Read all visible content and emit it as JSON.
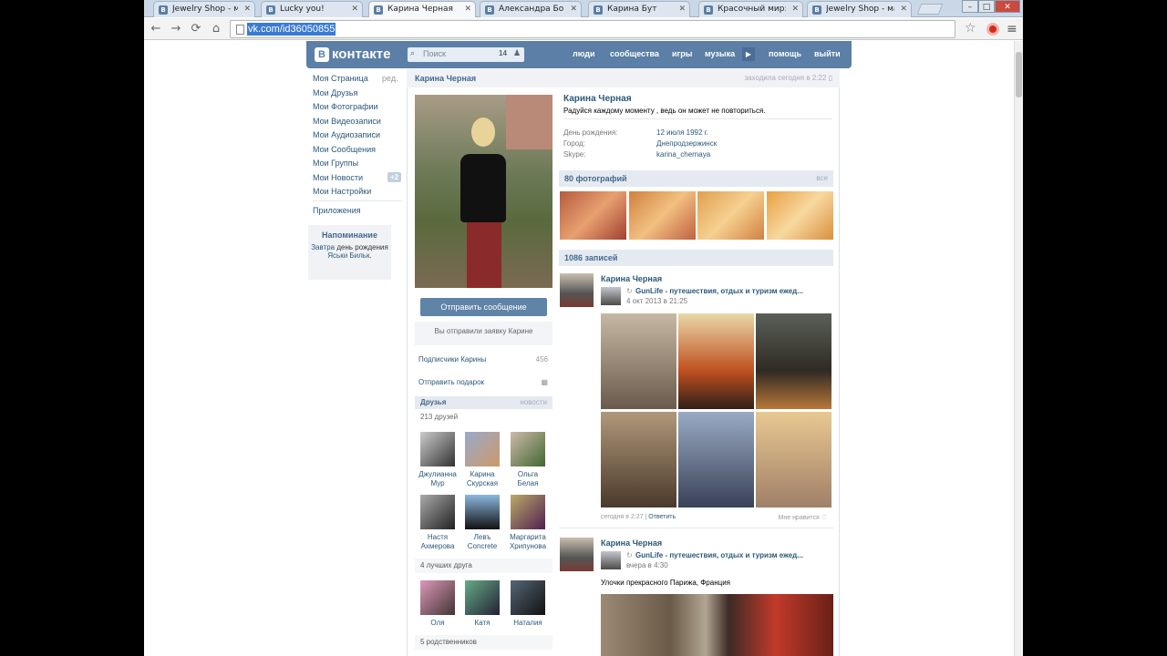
{
  "browser": {
    "tabs": [
      {
        "label": "Jewelry Shop - мага"
      },
      {
        "label": "Lucky you!"
      },
      {
        "label": "Карина Черная"
      },
      {
        "label": "Александра Бовча"
      },
      {
        "label": "Карина Бут"
      },
      {
        "label": "Красочный мир: Ус"
      },
      {
        "label": "Jewelry Shop - мага"
      }
    ],
    "url": "vk.com/id36050855",
    "window_controls": {
      "minimize": "–",
      "maximize": "□",
      "close": "✕"
    },
    "nav": {
      "back": "←",
      "forward": "→",
      "reload": "⟳",
      "home": "⌂",
      "star": "☆",
      "menu": "≡"
    }
  },
  "header": {
    "logo": "контакте",
    "logo_letter": "В",
    "search_placeholder": "Поиск",
    "search_count": "14",
    "nav": [
      "люди",
      "сообщества",
      "игры",
      "музыка",
      "помощь",
      "выйти"
    ],
    "play": "▶"
  },
  "left_nav": {
    "items": [
      "Моя Страница",
      "Мои Друзья",
      "Мои Фотографии",
      "Мои Видеозаписи",
      "Мои Аудиозаписи",
      "Мои Сообщения",
      "Мои Группы",
      "Мои Новости",
      "Мои Настройки"
    ],
    "edit": "ред.",
    "news_badge": "+2",
    "apps": "Приложения"
  },
  "reminder": {
    "title": "Напоминание",
    "word1": "Завтра",
    "word2": "день рождения",
    "name": "Яськи Бильк",
    "dot": "."
  },
  "profile": {
    "bar_name": "Карина Черная",
    "bar_online": "заходила сегодня в 2:22 ▯",
    "name": "Карина Черная",
    "status": "Радуйся каждому моменту , ведь он может не повториться.",
    "info": [
      {
        "k": "День рождения:",
        "v": "12 июля 1992 г."
      },
      {
        "k": "Город:",
        "v": "Днепродзержинск"
      },
      {
        "k": "Skype:",
        "v": "karina_chernaya"
      }
    ],
    "send_message": "Отправить сообщение",
    "request_note": "Вы отправили заявку Карине",
    "followers": "Подписчики Карины",
    "followers_count": "456",
    "gift": "Отправить подарок",
    "friends_title": "Друзья",
    "friends_link": "новости",
    "friends_count": "213 друзей",
    "friends": [
      {
        "first": "Джулианна",
        "last": "Мур"
      },
      {
        "first": "Карина",
        "last": "Скурская"
      },
      {
        "first": "Ольга",
        "last": "Белая"
      },
      {
        "first": "Настя",
        "last": "Ахмерова"
      },
      {
        "first": "Левъ",
        "last": "Concrete"
      },
      {
        "first": "Маргарита",
        "last": "Хрипунова"
      }
    ],
    "best_title": "4 лучших друга",
    "best": [
      {
        "first": "Оля"
      },
      {
        "first": "Катя"
      },
      {
        "first": "Наталия"
      }
    ],
    "relatives": "5 родственников"
  },
  "photos": {
    "title": "80 фотографий",
    "all": "все"
  },
  "wall": {
    "title": "1086 записей",
    "posts": [
      {
        "author": "Карина Черная",
        "source": "GunLife - путешествия, отдых и туризм ежед...",
        "date": "4 окт 2013 в 21:25",
        "footer_time": "сегодня в 2:27",
        "reply": "Ответить",
        "likes": "Мне нравится ♡"
      },
      {
        "author": "Карина Черная",
        "source": "GunLife - путешествия, отдых и туризм ежед...",
        "date": "вчера в 4:30",
        "text": "Улочки прекрасного Парижа, Франция"
      }
    ]
  },
  "colors": {
    "vk_blue": "#5b7fa6",
    "link": "#2b587a",
    "head_bg": "#e4eaf0"
  }
}
